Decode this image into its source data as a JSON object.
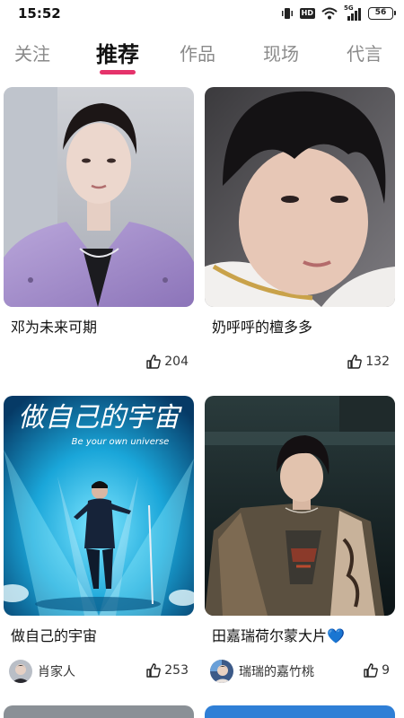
{
  "status_bar": {
    "time": "15:52",
    "network": "5G",
    "hd": "HD",
    "battery": "56"
  },
  "tabs": [
    {
      "label": "关注",
      "active": false
    },
    {
      "label": "推荐",
      "active": true
    },
    {
      "label": "作品",
      "active": false
    },
    {
      "label": "现场",
      "active": false
    },
    {
      "label": "代言",
      "active": false
    }
  ],
  "accent_color": "#e5336b",
  "cards": [
    {
      "title": "邓为未来可期",
      "likes": "204",
      "author": ""
    },
    {
      "title": "奶呼呼的檀多多",
      "likes": "132",
      "author": ""
    },
    {
      "title": "做自己的宇宙",
      "likes": "253",
      "author": "肖家人",
      "image_text": "做自己的宇宙",
      "image_subtext": "Be your own universe"
    },
    {
      "title": "田嘉瑞荷尔蒙大片💙",
      "likes": "9",
      "author": "瑞瑞的嘉竹桃"
    }
  ]
}
